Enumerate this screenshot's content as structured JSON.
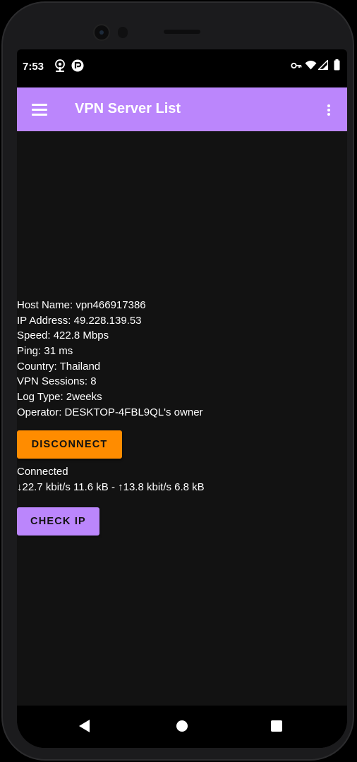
{
  "status_bar": {
    "time": "7:53",
    "left_icons": [
      "podcast-icon",
      "app-badge-icon"
    ],
    "right_icons": [
      "vpn-key-icon",
      "wifi-icon",
      "signal-icon",
      "battery-icon"
    ]
  },
  "app_bar": {
    "title": "VPN Server List",
    "menu_icon": "hamburger-menu-icon",
    "overflow_icon": "more-vert-icon"
  },
  "server_info": {
    "host_name": "Host Name: vpn466917386",
    "ip_address": "IP Address: 49.228.139.53",
    "speed": "Speed: 422.8 Mbps",
    "ping": "Ping: 31 ms",
    "country": "Country: Thailand",
    "vpn_sessions": "VPN Sessions: 8",
    "log_type": "Log Type: 2weeks",
    "operator": "Operator: DESKTOP-4FBL9QL's owner"
  },
  "actions": {
    "disconnect_label": "DISCONNECT",
    "check_ip_label": "CHECK IP"
  },
  "connection": {
    "state": "Connected",
    "traffic": "↓22.7 kbit/s 11.6 kB - ↑13.8 kbit/s 6.8 kB"
  },
  "colors": {
    "accent_purple": "#bb86fc",
    "disconnect_orange": "#ff8c00",
    "background": "#121212"
  }
}
